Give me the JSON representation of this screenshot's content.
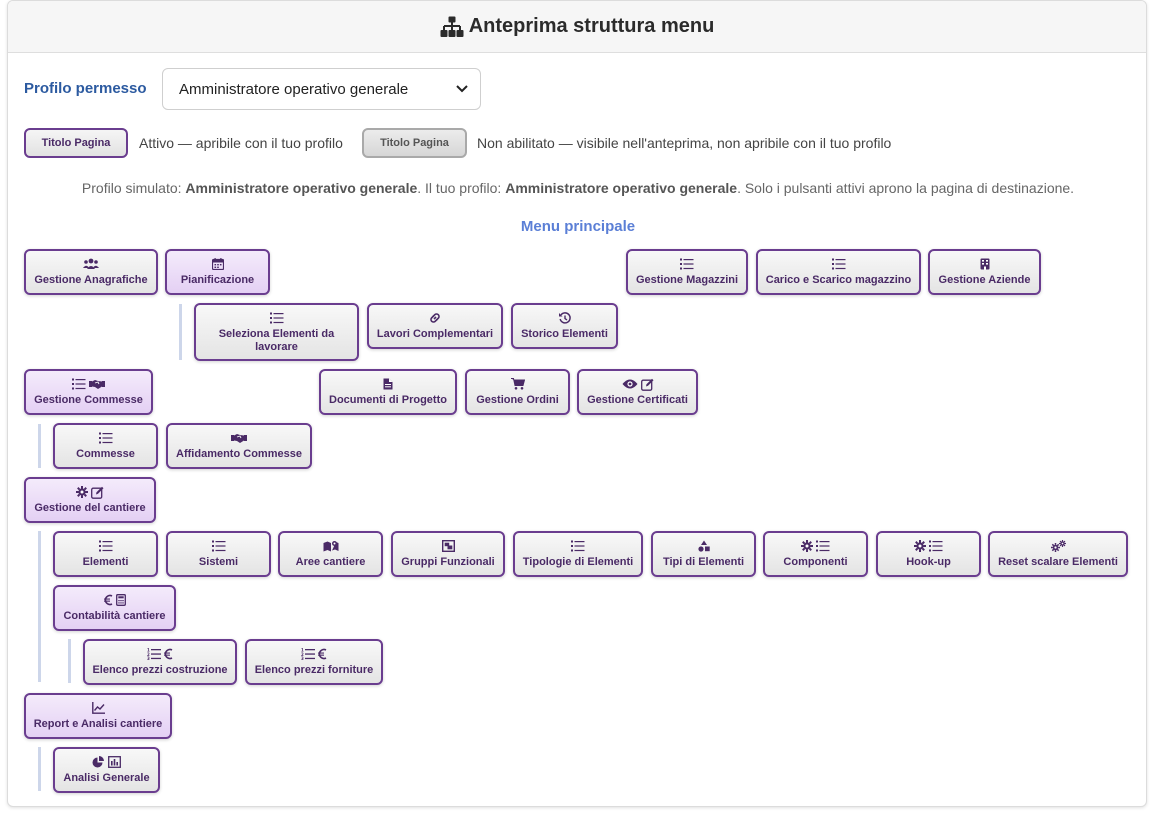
{
  "header": {
    "title": "Anteprima struttura menu",
    "icon": "sitemap-icon"
  },
  "profile": {
    "label": "Profilo permesso",
    "selected": "Amministratore operativo generale"
  },
  "legend": {
    "active_button": "Titolo Pagina",
    "active_text": "Attivo — apribile con il tuo profilo",
    "disabled_button": "Titolo Pagina",
    "disabled_text": "Non abilitato — visibile nell'anteprima, non apribile con il tuo profilo"
  },
  "info": {
    "prefix": "Profilo simulato: ",
    "simulated": "Amministratore operativo generale",
    "middle": ". Il tuo profilo: ",
    "yours": "Amministratore operativo generale",
    "suffix": ". Solo i pulsanti attivi aprono la pagina di destinazione."
  },
  "section_title": "Menu principale",
  "colors": {
    "accent": "#6a3d8f",
    "title_blue": "#2c5aa0",
    "section_blue": "#5b7fd6"
  },
  "menu": {
    "gestione_anagrafiche": "Gestione Anagrafiche",
    "pianificazione": "Pianificazione",
    "gestione_magazzini": "Gestione Magazzini",
    "carico_scarico": "Carico e Scarico magazzino",
    "gestione_aziende": "Gestione Aziende",
    "seleziona_elementi_1": "Seleziona Elementi da",
    "seleziona_elementi_2": "lavorare",
    "lavori_complementari": "Lavori Complementari",
    "storico_elementi": "Storico Elementi",
    "gestione_commesse": "Gestione Commesse",
    "documenti_progetto": "Documenti di Progetto",
    "gestione_ordini": "Gestione Ordini",
    "gestione_certificati": "Gestione Certificati",
    "commesse": "Commesse",
    "affidamento_commesse": "Affidamento Commesse",
    "gestione_cantiere": "Gestione del cantiere",
    "elementi": "Elementi",
    "sistemi": "Sistemi",
    "aree_cantiere": "Aree cantiere",
    "gruppi_funzionali": "Gruppi Funzionali",
    "tipologie_elementi": "Tipologie di Elementi",
    "tipi_elementi": "Tipi di Elementi",
    "componenti": "Componenti",
    "hook_up": "Hook-up",
    "reset_scalare": "Reset scalare Elementi",
    "contabilita_cantiere": "Contabilità cantiere",
    "elenco_prezzi_costruzione": "Elenco prezzi costruzione",
    "elenco_prezzi_forniture": "Elenco prezzi forniture",
    "report_analisi": "Report e Analisi cantiere",
    "analisi_generale": "Analisi Generale"
  }
}
